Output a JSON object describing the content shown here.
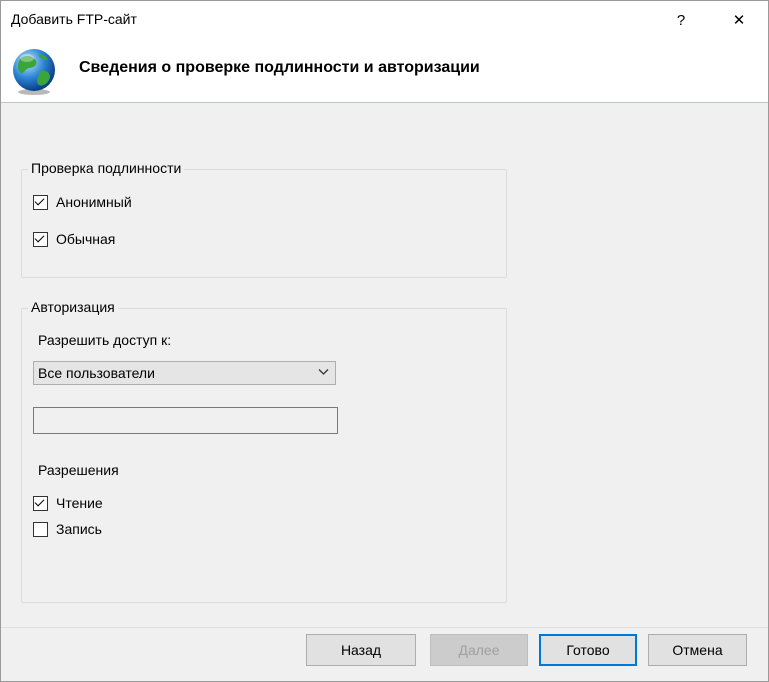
{
  "window": {
    "title": "Добавить FTP-сайт",
    "help": "?",
    "close": "✕"
  },
  "header": {
    "title": "Сведения о проверке подлинности и авторизации",
    "icon": "globe-icon"
  },
  "authentication": {
    "label": "Проверка подлинности",
    "options": [
      {
        "label": "Анонимный",
        "checked": true
      },
      {
        "label": "Обычная",
        "checked": true
      }
    ]
  },
  "authorization": {
    "label": "Авторизация",
    "allow_label": "Разрешить доступ к:",
    "allow_value": "Все пользователи",
    "allow_input_value": "",
    "permissions_label": "Разрешения",
    "permissions": [
      {
        "label": "Чтение",
        "checked": true
      },
      {
        "label": "Запись",
        "checked": false
      }
    ]
  },
  "buttons": {
    "back": "Назад",
    "next": "Далее",
    "finish": "Готово",
    "cancel": "Отмена"
  },
  "colors": {
    "accent": "#0078d7",
    "panel": "#f0f0f0"
  }
}
